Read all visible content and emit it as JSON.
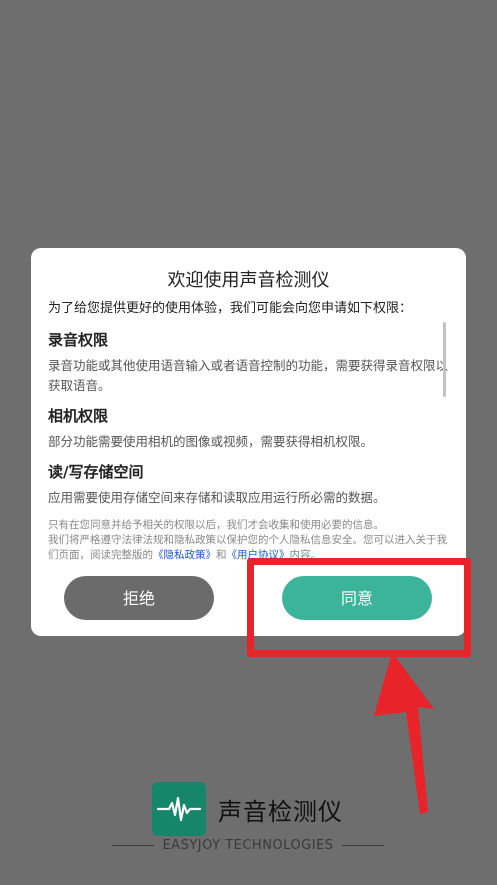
{
  "dialog": {
    "title": "欢迎使用声音检测仪",
    "intro": "为了给您提供更好的使用体验，我们可能会向您申请如下权限：",
    "permissions": [
      {
        "title": "录音权限",
        "desc": "录音功能或其他使用语音输入或者语音控制的功能，需要获得录音权限以获取语音。"
      },
      {
        "title": "相机权限",
        "desc": "部分功能需要使用相机的图像或视频，需要获得相机权限。"
      },
      {
        "title": "读/写存储空间",
        "desc": "应用需要使用存储空间来存储和读取应用运行所必需的数据。"
      }
    ],
    "notice_line1": "只有在您同意并给予相关的权限以后，我们才会收集和使用必要的信息。",
    "notice_line2": "我们将严格遵守法律法规和隐私政策以保护您的个人隐私信息安全。您可以进入关于我们页面，阅读完整版的",
    "privacy_link": "《隐私政策》",
    "and_text": "和",
    "agreement_link": "《用户协议》",
    "notice_tail": "内容。",
    "refuse_label": "拒绝",
    "agree_label": "同意"
  },
  "splash": {
    "app_name": "声音检测仪",
    "company": "EASYJOY TECHNOLOGIES"
  },
  "colors": {
    "overlay": "#6e6e6e",
    "agree_green": "#3cb49a",
    "refuse_gray": "#6b6b6b",
    "highlight_red": "#e8232a",
    "logo_green": "#16866a",
    "link_blue": "#1a57d6"
  },
  "icons": {
    "logo": "waveform-icon",
    "annotation": "arrow-up-icon"
  }
}
